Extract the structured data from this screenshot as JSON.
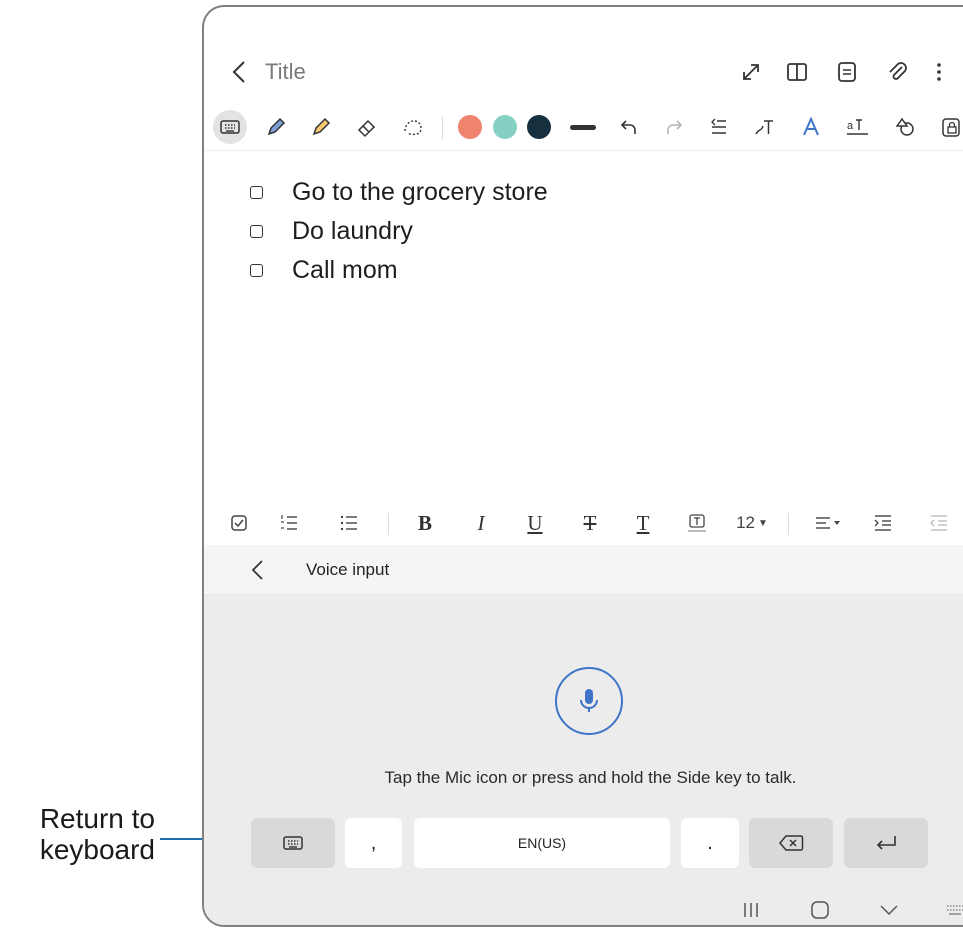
{
  "callout": {
    "line1": "Return to",
    "line2": "keyboard"
  },
  "note": {
    "title": "Title",
    "checklist": [
      {
        "label": "Go to the grocery store"
      },
      {
        "label": "Do laundry"
      },
      {
        "label": "Call mom"
      }
    ]
  },
  "toolbar": {
    "pen_colors": [
      "#f0826e",
      "#86d0c3",
      "#17303f"
    ]
  },
  "format_bar": {
    "bold": "B",
    "italic": "I",
    "underline": "U",
    "strike": "T",
    "text_color": "T",
    "font_size": "12"
  },
  "voice": {
    "title": "Voice input",
    "hint": "Tap the Mic icon or press and hold the Side key to talk."
  },
  "keys": {
    "comma": ",",
    "space": "EN(US)",
    "period": "."
  },
  "colors": {
    "accent": "#3e74c9",
    "callout_line": "#1f6fb2"
  }
}
